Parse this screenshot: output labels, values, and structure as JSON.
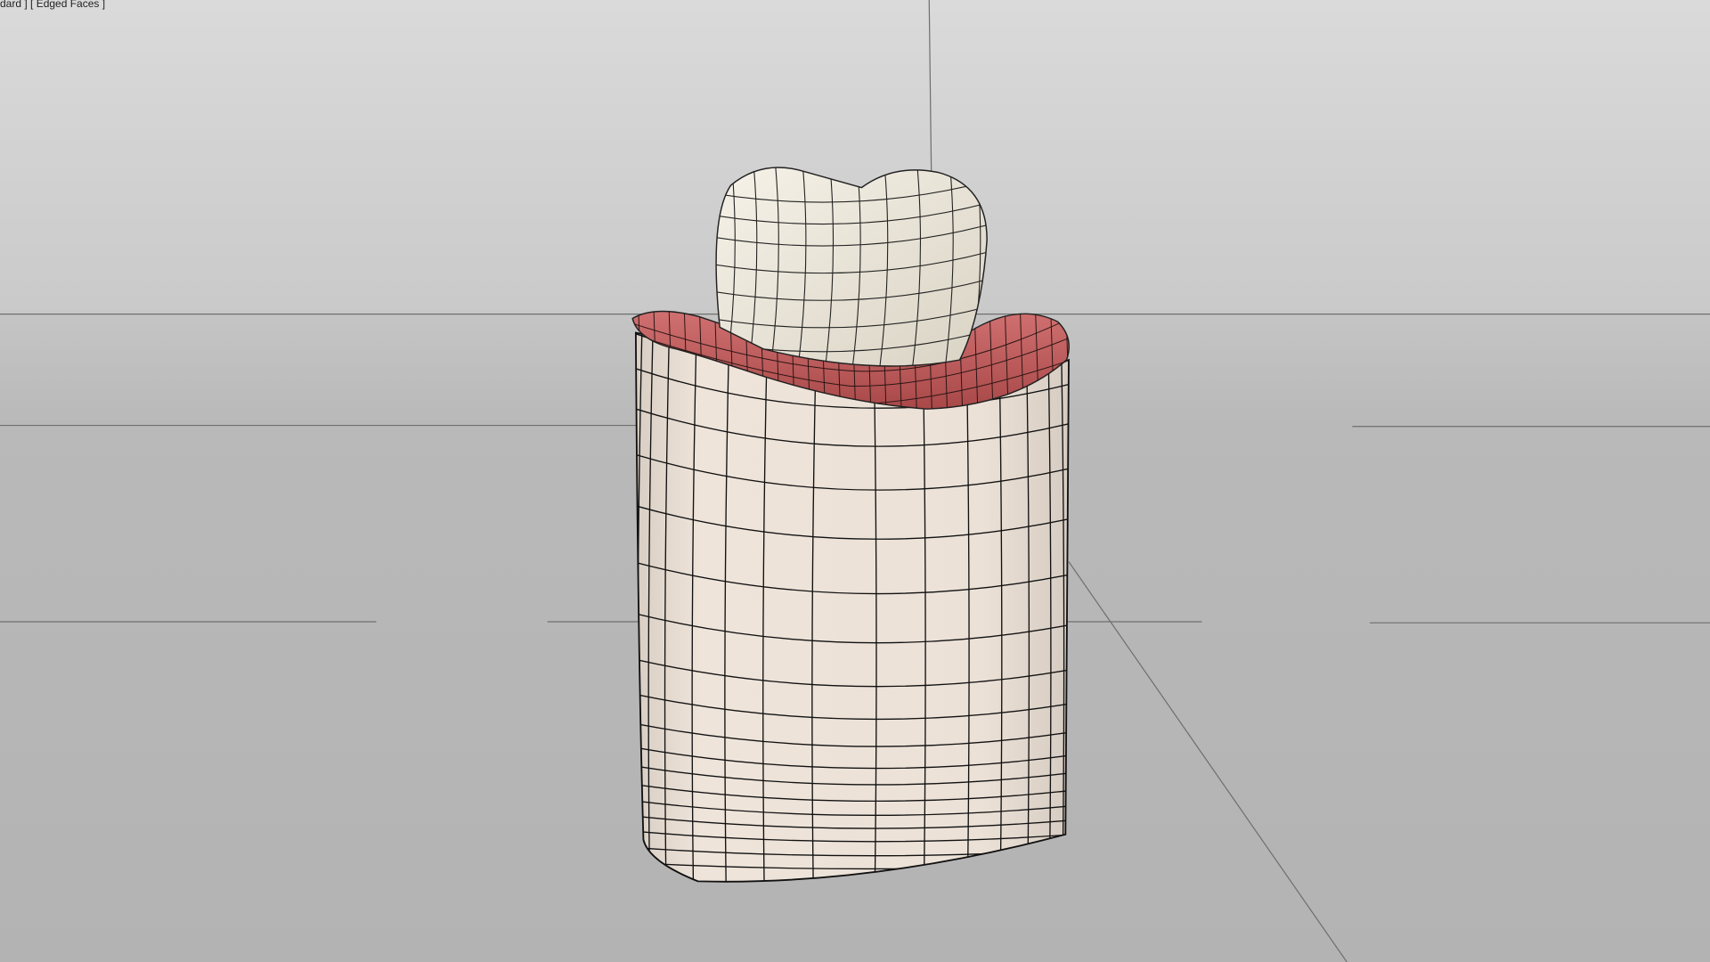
{
  "viewport": {
    "label": "dard ] [ Edged Faces ]",
    "shading_mode": "Edged Faces"
  },
  "colors": {
    "sky_top": "#dadada",
    "horizon": "#c6c6c6",
    "ground": "#b5b5b5",
    "grid_line": "#777777",
    "tooth": "#efeadd",
    "gum": "#c0585a",
    "block": "#eae0d6",
    "wire": "#111111"
  }
}
